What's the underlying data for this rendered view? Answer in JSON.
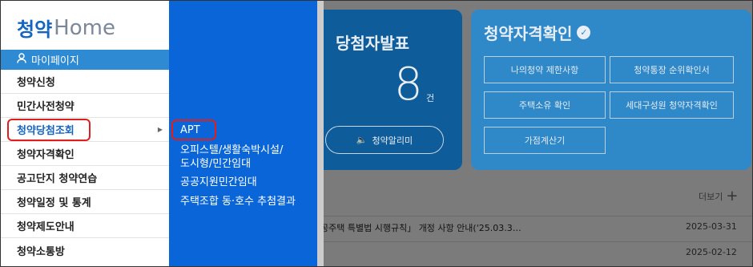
{
  "background": {
    "winner": {
      "title": "당첨자발표",
      "count": "8",
      "unit": "건",
      "alarm_label": "청약알리미"
    },
    "eligibility": {
      "title": "청약자격확인",
      "buttons": [
        "나의청약 제한사항",
        "청약통장 순위확인서",
        "주택소유 확인",
        "세대구성원 청약자격확인",
        "가점계산기"
      ]
    },
    "more_label": "더보기",
    "notices": [
      {
        "text": "공주택 특별법 시행규칙」 개정 사항 안내('25.03.3…",
        "date": "2025-03-31"
      },
      {
        "text": "",
        "date": "2025-02-12"
      }
    ]
  },
  "logo": {
    "prefix": "청약",
    "suffix": "Home"
  },
  "mypage_label": "마이페이지",
  "menu_items": [
    "청약신청",
    "민간사전청약",
    "청약당첨조회",
    "청약자격확인",
    "공고단지 청약연습",
    "청약일정 및 통계",
    "청약제도안내",
    "청약소통방"
  ],
  "submenu": [
    "APT",
    "오피스텔/생활숙박시설/\n도시형/민간임대",
    "공공지원민간임대",
    "주택조합 동·호수 추첨결과"
  ],
  "colors": {
    "menu_active": "#1565c0",
    "submenu_bg": "#0a66d8",
    "highlight": "#e01e1e",
    "mypage_bg": "#2d8ad3"
  }
}
